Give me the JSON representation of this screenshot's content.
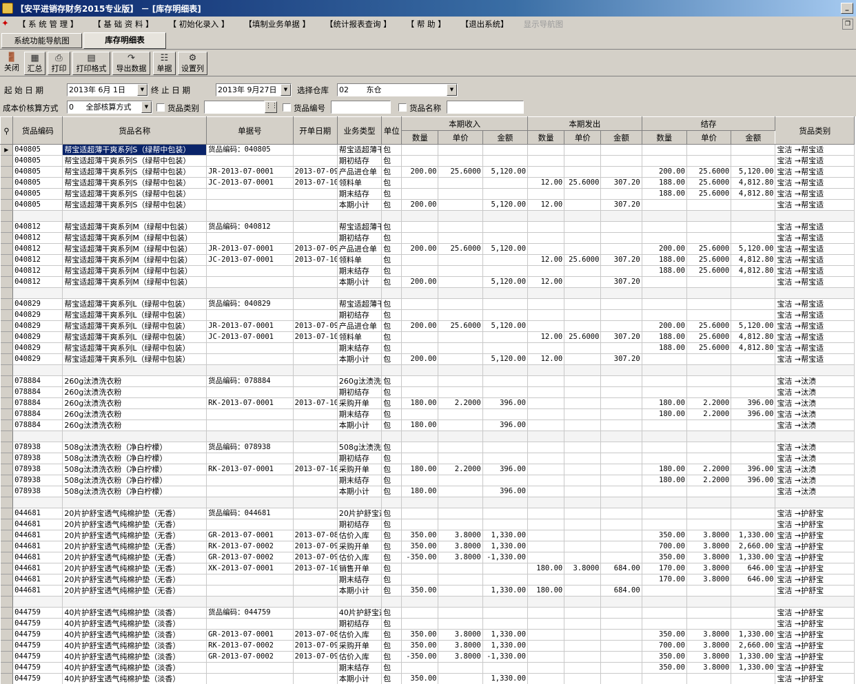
{
  "window": {
    "title": "【安平进销存财务2015专业版】 － [库存明细表]",
    "minimize": "_"
  },
  "menu": {
    "items": [
      "【 系 统 管 理 】",
      "【 基 础 资 料 】",
      "【 初始化录入 】",
      "【填制业务单据 】",
      "【统计报表查询 】",
      "【 帮 助 】",
      "【退出系统】"
    ],
    "disabled_item": "显示导航图"
  },
  "tabs": [
    "系统功能导航图",
    "库存明细表"
  ],
  "toolbar": [
    {
      "label": "关闭",
      "icon": "close-door-icon"
    },
    {
      "label": "汇总",
      "icon": "summary-icon"
    },
    {
      "label": "打印",
      "icon": "printer-icon"
    },
    {
      "label": "打印格式",
      "icon": "print-format-icon"
    },
    {
      "label": "导出数据",
      "icon": "export-icon"
    },
    {
      "label": "单据",
      "icon": "document-icon"
    },
    {
      "label": "设置列",
      "icon": "gear-icon"
    }
  ],
  "filters": {
    "start_label": "起 始 日 期",
    "start_date": "2013年 6月 1日",
    "end_label": "终 止 日 期",
    "end_date": "2013年 9月27日",
    "warehouse_label": "选择仓库",
    "warehouse_code": "02",
    "warehouse_name": "东仓",
    "cost_label": "成本价核算方式",
    "cost_code": "0",
    "cost_name": "全部核算方式",
    "category_label": "货品类别",
    "category_value": "",
    "code_label": "货品编号",
    "code_value": "",
    "name_label": "货品名称",
    "name_value": ""
  },
  "grid": {
    "headers": {
      "code": "货品编码",
      "name": "货品名称",
      "doc": "单据号",
      "date": "开单日期",
      "type": "业务类型",
      "unit": "单位",
      "in_group": "本期收入",
      "out_group": "本期发出",
      "bal_group": "结存",
      "qty": "数量",
      "price": "单价",
      "amount": "金额",
      "category": "货品类别"
    },
    "rows": [
      [
        "040805",
        "帮宝适超薄干爽系列S（绿帮中包装）",
        "货品编码：040805",
        "",
        "帮宝适超薄干",
        "包",
        "",
        "",
        "",
        "",
        "",
        "",
        "",
        "",
        "",
        "宝洁 →帮宝适"
      ],
      [
        "040805",
        "帮宝适超薄干爽系列S（绿帮中包装）",
        "",
        "",
        "期初结存",
        "包",
        "",
        "",
        "",
        "",
        "",
        "",
        "",
        "",
        "",
        "宝洁 →帮宝适"
      ],
      [
        "040805",
        "帮宝适超薄干爽系列S（绿帮中包装）",
        "JR-2013-07-0001",
        "2013-07-09",
        "产品进仓单",
        "包",
        "200.00",
        "25.6000",
        "5,120.00",
        "",
        "",
        "",
        "200.00",
        "25.6000",
        "5,120.00",
        "宝洁 →帮宝适"
      ],
      [
        "040805",
        "帮宝适超薄干爽系列S（绿帮中包装）",
        "JC-2013-07-0001",
        "2013-07-10",
        "领料单",
        "包",
        "",
        "",
        "",
        "12.00",
        "25.6000",
        "307.20",
        "188.00",
        "25.6000",
        "4,812.80",
        "宝洁 →帮宝适"
      ],
      [
        "040805",
        "帮宝适超薄干爽系列S（绿帮中包装）",
        "",
        "",
        "期末结存",
        "包",
        "",
        "",
        "",
        "",
        "",
        "",
        "188.00",
        "25.6000",
        "4,812.80",
        "宝洁 →帮宝适"
      ],
      [
        "040805",
        "帮宝适超薄干爽系列S（绿帮中包装）",
        "",
        "",
        "本期小计",
        "包",
        "200.00",
        "",
        "5,120.00",
        "12.00",
        "",
        "307.20",
        "",
        "",
        "",
        "宝洁 →帮宝适"
      ],
      [],
      [
        "040812",
        "帮宝适超薄干爽系列M（绿帮中包装）",
        "货品编码：040812",
        "",
        "帮宝适超薄干",
        "包",
        "",
        "",
        "",
        "",
        "",
        "",
        "",
        "",
        "",
        "宝洁 →帮宝适"
      ],
      [
        "040812",
        "帮宝适超薄干爽系列M（绿帮中包装）",
        "",
        "",
        "期初结存",
        "包",
        "",
        "",
        "",
        "",
        "",
        "",
        "",
        "",
        "",
        "宝洁 →帮宝适"
      ],
      [
        "040812",
        "帮宝适超薄干爽系列M（绿帮中包装）",
        "JR-2013-07-0001",
        "2013-07-09",
        "产品进仓单",
        "包",
        "200.00",
        "25.6000",
        "5,120.00",
        "",
        "",
        "",
        "200.00",
        "25.6000",
        "5,120.00",
        "宝洁 →帮宝适"
      ],
      [
        "040812",
        "帮宝适超薄干爽系列M（绿帮中包装）",
        "JC-2013-07-0001",
        "2013-07-10",
        "领料单",
        "包",
        "",
        "",
        "",
        "12.00",
        "25.6000",
        "307.20",
        "188.00",
        "25.6000",
        "4,812.80",
        "宝洁 →帮宝适"
      ],
      [
        "040812",
        "帮宝适超薄干爽系列M（绿帮中包装）",
        "",
        "",
        "期末结存",
        "包",
        "",
        "",
        "",
        "",
        "",
        "",
        "188.00",
        "25.6000",
        "4,812.80",
        "宝洁 →帮宝适"
      ],
      [
        "040812",
        "帮宝适超薄干爽系列M（绿帮中包装）",
        "",
        "",
        "本期小计",
        "包",
        "200.00",
        "",
        "5,120.00",
        "12.00",
        "",
        "307.20",
        "",
        "",
        "",
        "宝洁 →帮宝适"
      ],
      [],
      [
        "040829",
        "帮宝适超薄干爽系列L（绿帮中包装）",
        "货品编码：040829",
        "",
        "帮宝适超薄干",
        "包",
        "",
        "",
        "",
        "",
        "",
        "",
        "",
        "",
        "",
        "宝洁 →帮宝适"
      ],
      [
        "040829",
        "帮宝适超薄干爽系列L（绿帮中包装）",
        "",
        "",
        "期初结存",
        "包",
        "",
        "",
        "",
        "",
        "",
        "",
        "",
        "",
        "",
        "宝洁 →帮宝适"
      ],
      [
        "040829",
        "帮宝适超薄干爽系列L（绿帮中包装）",
        "JR-2013-07-0001",
        "2013-07-09",
        "产品进仓单",
        "包",
        "200.00",
        "25.6000",
        "5,120.00",
        "",
        "",
        "",
        "200.00",
        "25.6000",
        "5,120.00",
        "宝洁 →帮宝适"
      ],
      [
        "040829",
        "帮宝适超薄干爽系列L（绿帮中包装）",
        "JC-2013-07-0001",
        "2013-07-10",
        "领料单",
        "包",
        "",
        "",
        "",
        "12.00",
        "25.6000",
        "307.20",
        "188.00",
        "25.6000",
        "4,812.80",
        "宝洁 →帮宝适"
      ],
      [
        "040829",
        "帮宝适超薄干爽系列L（绿帮中包装）",
        "",
        "",
        "期末结存",
        "包",
        "",
        "",
        "",
        "",
        "",
        "",
        "188.00",
        "25.6000",
        "4,812.80",
        "宝洁 →帮宝适"
      ],
      [
        "040829",
        "帮宝适超薄干爽系列L（绿帮中包装）",
        "",
        "",
        "本期小计",
        "包",
        "200.00",
        "",
        "5,120.00",
        "12.00",
        "",
        "307.20",
        "",
        "",
        "",
        "宝洁 →帮宝适"
      ],
      [],
      [
        "078884",
        "260g汰渍洗衣粉",
        "货品编码：078884",
        "",
        "260g汰渍洗衣",
        "包",
        "",
        "",
        "",
        "",
        "",
        "",
        "",
        "",
        "",
        "宝洁 →汰渍"
      ],
      [
        "078884",
        "260g汰渍洗衣粉",
        "",
        "",
        "期初结存",
        "包",
        "",
        "",
        "",
        "",
        "",
        "",
        "",
        "",
        "",
        "宝洁 →汰渍"
      ],
      [
        "078884",
        "260g汰渍洗衣粉",
        "RK-2013-07-0001",
        "2013-07-10",
        "采购开单",
        "包",
        "180.00",
        "2.2000",
        "396.00",
        "",
        "",
        "",
        "180.00",
        "2.2000",
        "396.00",
        "宝洁 →汰渍"
      ],
      [
        "078884",
        "260g汰渍洗衣粉",
        "",
        "",
        "期末结存",
        "包",
        "",
        "",
        "",
        "",
        "",
        "",
        "180.00",
        "2.2000",
        "396.00",
        "宝洁 →汰渍"
      ],
      [
        "078884",
        "260g汰渍洗衣粉",
        "",
        "",
        "本期小计",
        "包",
        "180.00",
        "",
        "396.00",
        "",
        "",
        "",
        "",
        "",
        "",
        "宝洁 →汰渍"
      ],
      [],
      [
        "078938",
        "508g汰渍洗衣粉（净白柠檬）",
        "货品编码：078938",
        "",
        "508g汰渍洗衣",
        "包",
        "",
        "",
        "",
        "",
        "",
        "",
        "",
        "",
        "",
        "宝洁 →汰渍"
      ],
      [
        "078938",
        "508g汰渍洗衣粉（净白柠檬）",
        "",
        "",
        "期初结存",
        "包",
        "",
        "",
        "",
        "",
        "",
        "",
        "",
        "",
        "",
        "宝洁 →汰渍"
      ],
      [
        "078938",
        "508g汰渍洗衣粉（净白柠檬）",
        "RK-2013-07-0001",
        "2013-07-10",
        "采购开单",
        "包",
        "180.00",
        "2.2000",
        "396.00",
        "",
        "",
        "",
        "180.00",
        "2.2000",
        "396.00",
        "宝洁 →汰渍"
      ],
      [
        "078938",
        "508g汰渍洗衣粉（净白柠檬）",
        "",
        "",
        "期末结存",
        "包",
        "",
        "",
        "",
        "",
        "",
        "",
        "180.00",
        "2.2000",
        "396.00",
        "宝洁 →汰渍"
      ],
      [
        "078938",
        "508g汰渍洗衣粉（净白柠檬）",
        "",
        "",
        "本期小计",
        "包",
        "180.00",
        "",
        "396.00",
        "",
        "",
        "",
        "",
        "",
        "",
        "宝洁 →汰渍"
      ],
      [],
      [
        "044681",
        "20片护舒宝透气纯棉护垫（无香）",
        "货品编码：044681",
        "",
        "20片护舒宝透",
        "包",
        "",
        "",
        "",
        "",
        "",
        "",
        "",
        "",
        "",
        "宝洁 →护舒宝"
      ],
      [
        "044681",
        "20片护舒宝透气纯棉护垫（无香）",
        "",
        "",
        "期初结存",
        "包",
        "",
        "",
        "",
        "",
        "",
        "",
        "",
        "",
        "",
        "宝洁 →护舒宝"
      ],
      [
        "044681",
        "20片护舒宝透气纯棉护垫（无香）",
        "GR-2013-07-0001",
        "2013-07-08",
        "估价入库",
        "包",
        "350.00",
        "3.8000",
        "1,330.00",
        "",
        "",
        "",
        "350.00",
        "3.8000",
        "1,330.00",
        "宝洁 →护舒宝"
      ],
      [
        "044681",
        "20片护舒宝透气纯棉护垫（无香）",
        "RK-2013-07-0002",
        "2013-07-09",
        "采购开单",
        "包",
        "350.00",
        "3.8000",
        "1,330.00",
        "",
        "",
        "",
        "700.00",
        "3.8000",
        "2,660.00",
        "宝洁 →护舒宝"
      ],
      [
        "044681",
        "20片护舒宝透气纯棉护垫（无香）",
        "GR-2013-07-0002",
        "2013-07-09",
        "估价入库",
        "包",
        "-350.00",
        "3.8000",
        "-1,330.00",
        "",
        "",
        "",
        "350.00",
        "3.8000",
        "1,330.00",
        "宝洁 →护舒宝"
      ],
      [
        "044681",
        "20片护舒宝透气纯棉护垫（无香）",
        "XK-2013-07-0001",
        "2013-07-10",
        "销售开单",
        "包",
        "",
        "",
        "",
        "180.00",
        "3.8000",
        "684.00",
        "170.00",
        "3.8000",
        "646.00",
        "宝洁 →护舒宝"
      ],
      [
        "044681",
        "20片护舒宝透气纯棉护垫（无香）",
        "",
        "",
        "期末结存",
        "包",
        "",
        "",
        "",
        "",
        "",
        "",
        "170.00",
        "3.8000",
        "646.00",
        "宝洁 →护舒宝"
      ],
      [
        "044681",
        "20片护舒宝透气纯棉护垫（无香）",
        "",
        "",
        "本期小计",
        "包",
        "350.00",
        "",
        "1,330.00",
        "180.00",
        "",
        "684.00",
        "",
        "",
        "",
        "宝洁 →护舒宝"
      ],
      [],
      [
        "044759",
        "40片护舒宝透气纯棉护垫（淡香）",
        "货品编码：044759",
        "",
        "40片护舒宝透",
        "包",
        "",
        "",
        "",
        "",
        "",
        "",
        "",
        "",
        "",
        "宝洁 →护舒宝"
      ],
      [
        "044759",
        "40片护舒宝透气纯棉护垫（淡香）",
        "",
        "",
        "期初结存",
        "包",
        "",
        "",
        "",
        "",
        "",
        "",
        "",
        "",
        "",
        "宝洁 →护舒宝"
      ],
      [
        "044759",
        "40片护舒宝透气纯棉护垫（淡香）",
        "GR-2013-07-0001",
        "2013-07-08",
        "估价入库",
        "包",
        "350.00",
        "3.8000",
        "1,330.00",
        "",
        "",
        "",
        "350.00",
        "3.8000",
        "1,330.00",
        "宝洁 →护舒宝"
      ],
      [
        "044759",
        "40片护舒宝透气纯棉护垫（淡香）",
        "RK-2013-07-0002",
        "2013-07-09",
        "采购开单",
        "包",
        "350.00",
        "3.8000",
        "1,330.00",
        "",
        "",
        "",
        "700.00",
        "3.8000",
        "2,660.00",
        "宝洁 →护舒宝"
      ],
      [
        "044759",
        "40片护舒宝透气纯棉护垫（淡香）",
        "GR-2013-07-0002",
        "2013-07-09",
        "估价入库",
        "包",
        "-350.00",
        "3.8000",
        "-1,330.00",
        "",
        "",
        "",
        "350.00",
        "3.8000",
        "1,330.00",
        "宝洁 →护舒宝"
      ],
      [
        "044759",
        "40片护舒宝透气纯棉护垫（淡香）",
        "",
        "",
        "期末结存",
        "包",
        "",
        "",
        "",
        "",
        "",
        "",
        "350.00",
        "3.8000",
        "1,330.00",
        "宝洁 →护舒宝"
      ],
      [
        "044759",
        "40片护舒宝透气纯棉护垫（淡香）",
        "",
        "",
        "本期小计",
        "包",
        "350.00",
        "",
        "1,330.00",
        "",
        "",
        "",
        "",
        "",
        "",
        "宝洁 →护舒宝"
      ]
    ]
  }
}
